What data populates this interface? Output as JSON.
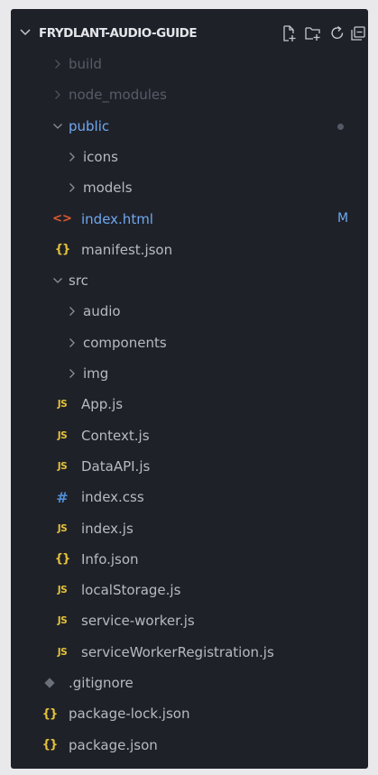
{
  "explorer": {
    "title": "FRYDLANT-AUDIO-GUIDE",
    "actions": [
      {
        "name": "new-file-icon",
        "label": "New File"
      },
      {
        "name": "new-folder-icon",
        "label": "New Folder"
      },
      {
        "name": "refresh-icon",
        "label": "Refresh"
      },
      {
        "name": "collapse-all-icon",
        "label": "Collapse Folders"
      }
    ]
  },
  "tree": [
    {
      "label": "build",
      "kind": "folder",
      "expanded": false,
      "depth": 1,
      "dim": true
    },
    {
      "label": "node_modules",
      "kind": "folder",
      "expanded": false,
      "depth": 1,
      "dim": true
    },
    {
      "label": "public",
      "kind": "folder",
      "expanded": true,
      "depth": 1,
      "highlight": true,
      "modified_dot": true
    },
    {
      "label": "icons",
      "kind": "folder",
      "expanded": false,
      "depth": 2
    },
    {
      "label": "models",
      "kind": "folder",
      "expanded": false,
      "depth": 2
    },
    {
      "label": "index.html",
      "kind": "html",
      "depth": 2,
      "highlight": true,
      "badge": "M"
    },
    {
      "label": "manifest.json",
      "kind": "json",
      "depth": 2
    },
    {
      "label": "src",
      "kind": "folder",
      "expanded": true,
      "depth": 1
    },
    {
      "label": "audio",
      "kind": "folder",
      "expanded": false,
      "depth": 2
    },
    {
      "label": "components",
      "kind": "folder",
      "expanded": false,
      "depth": 2
    },
    {
      "label": "img",
      "kind": "folder",
      "expanded": false,
      "depth": 2
    },
    {
      "label": "App.js",
      "kind": "js",
      "depth": 2
    },
    {
      "label": "Context.js",
      "kind": "js",
      "depth": 2
    },
    {
      "label": "DataAPI.js",
      "kind": "js",
      "depth": 2
    },
    {
      "label": "index.css",
      "kind": "css",
      "depth": 2
    },
    {
      "label": "index.js",
      "kind": "js",
      "depth": 2
    },
    {
      "label": "Info.json",
      "kind": "json",
      "depth": 2
    },
    {
      "label": "localStorage.js",
      "kind": "js",
      "depth": 2
    },
    {
      "label": "service-worker.js",
      "kind": "js",
      "depth": 2
    },
    {
      "label": "serviceWorkerRegistration.js",
      "kind": "js",
      "depth": 2
    },
    {
      "label": ".gitignore",
      "kind": "git",
      "depth": 1
    },
    {
      "label": "package-lock.json",
      "kind": "json",
      "depth": 1
    },
    {
      "label": "package.json",
      "kind": "json",
      "depth": 1
    }
  ],
  "icon_glyphs": {
    "js": "JS",
    "json": "{}",
    "css": "#",
    "html": "<>"
  },
  "colors": {
    "background": "#1f2129",
    "text": "#b7bac2",
    "dim_text": "#585c67",
    "highlight": "#6fa8ef",
    "js_yellow": "#e3c23a",
    "css_blue": "#4f8fd6",
    "html_orange": "#e15b2d",
    "git_gray": "#6b6f7a",
    "dot_gray": "#545966"
  }
}
